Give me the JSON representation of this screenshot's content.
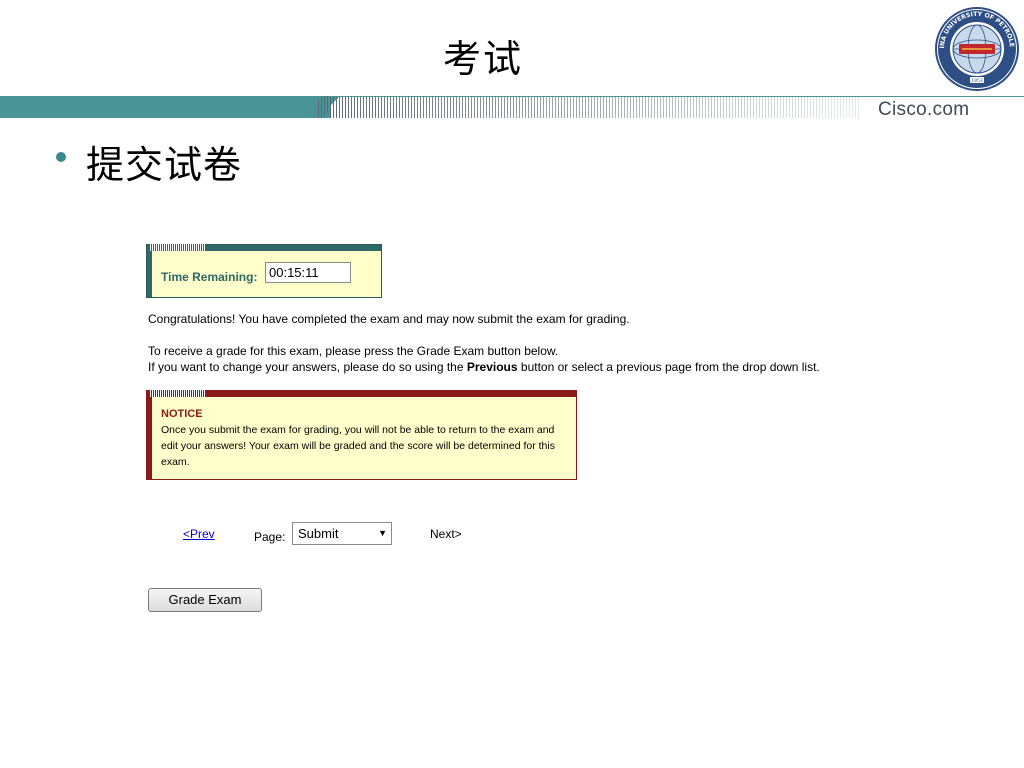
{
  "slide": {
    "title": "考试",
    "bullet": "提交试卷"
  },
  "header": {
    "brand": "Cisco.com",
    "seal_text": "CHINA UNIVERSITY OF PETROLEUM",
    "seal_year": "1953",
    "colors": {
      "bar": "#3a8a8c",
      "brand_text": "#3f4a52"
    }
  },
  "exam": {
    "timer": {
      "label": "Time Remaining:",
      "value": "00:15:11"
    },
    "congrats": "Congratulations! You have completed the exam and may now submit the exam for grading.",
    "instruction_1": "To receive a grade for this exam, please press the Grade Exam button below.",
    "instruction_2_pre": "If you want to change your answers, please do so using the ",
    "instruction_2_bold": "Previous",
    "instruction_2_post": " button or select a previous page from the drop down list.",
    "notice": {
      "title": "NOTICE",
      "body": "Once you submit the exam for grading, you will not be able to return to the exam and edit your answers! Your exam will be graded and the score will be determined for this exam."
    },
    "nav": {
      "prev": "<Prev",
      "page_label": "Page:",
      "page_value": "Submit",
      "next": "Next>"
    },
    "grade_button": "Grade Exam",
    "colors": {
      "timer_accent": "#2d6a67",
      "notice_accent": "#8b1a1a",
      "panel_bg": "#ffffcc",
      "link": "#0000cc"
    }
  }
}
